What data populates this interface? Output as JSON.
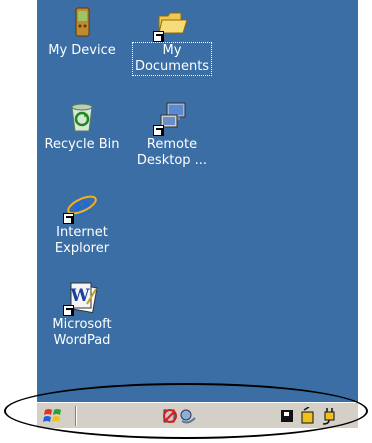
{
  "desktop": {
    "background_color": "#3a6ea5",
    "icons": [
      {
        "label": "My Device",
        "icon": "my-device-icon"
      },
      {
        "label": "My\nDocuments",
        "icon": "folder-icon"
      },
      {
        "label": "Recycle Bin",
        "icon": "recycle-bin-icon"
      },
      {
        "label": "Remote\nDesktop ...",
        "icon": "remote-desktop-icon"
      },
      {
        "label": "Internet\nExplorer",
        "icon": "internet-explorer-icon"
      },
      {
        "label": "Microsoft\nWordPad",
        "icon": "wordpad-icon"
      }
    ]
  },
  "taskbar": {
    "start_icon": "windows-start-icon",
    "tray_icons": [
      "network-status-icon",
      "activesync-icon",
      "memory-card-icon",
      "battery-icon",
      "power-plug-icon"
    ]
  }
}
